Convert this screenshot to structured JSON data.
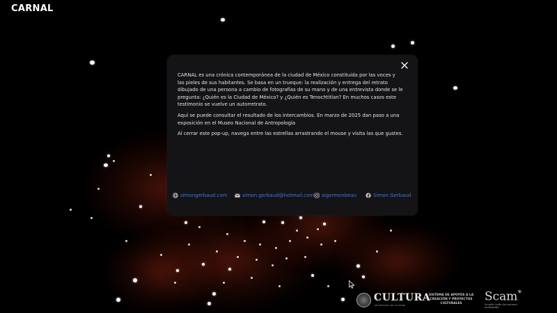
{
  "app": {
    "title": "CARNAL"
  },
  "modal": {
    "close_icon": "close-icon",
    "paragraphs": [
      "CARNAL es una crónica contemporánea de la ciudad de México constituida por las voces y las pieles de sus habitantes. Se basa en un trueque: la realización y entrega del retrato dibujado de una persona a cambio de fotografías de su mano y de una entrevista donde se le pregunta: ¿Quién es la Ciudad de México? y ¿Quién es Tenochtitlan? En muchos casos este testimonio se vuelve un autorretrato.",
      "Aquí se puede consultar el resultado de los intercambios. En marzo de 2025 dan paso a una exposición en el Museo Nacional de Antropología",
      "Al cerrar este pop-up, navega entre las estrellas arrastrando el mouse y visita las que gustes."
    ],
    "links": [
      {
        "icon": "globe-icon",
        "label": "simongerbaud.com"
      },
      {
        "icon": "mail-icon",
        "label": "simon.gerbaud@hotmail.com"
      },
      {
        "icon": "instagram-icon",
        "label": "sigermonbeau"
      },
      {
        "icon": "facebook-icon",
        "label": "Simon Gerbaud"
      }
    ],
    "link_color": "#3b78e6"
  },
  "footer": {
    "cultura": {
      "name": "CULTURA",
      "sub": "SECRETARÍA DE CULTURA"
    },
    "sistema": "SISTEMA DE APOYOS A LA CREACIÓN Y PROYECTOS CULTURALES",
    "scam": {
      "name": "Scam",
      "star": "*",
      "sub": "Société civile des auteurs multimedia"
    }
  },
  "colors": {
    "background": "#000000",
    "modal": "#141416",
    "nebula": "#96281a"
  }
}
